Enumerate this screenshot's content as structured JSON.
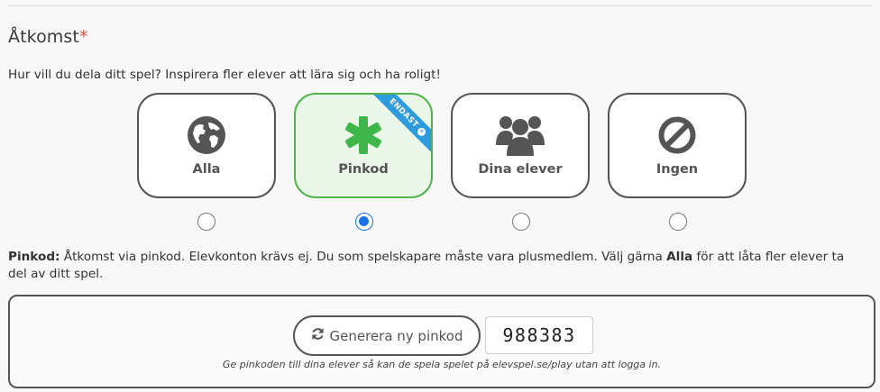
{
  "section": {
    "title": "Åtkomst",
    "required_mark": "*"
  },
  "question": "Hur vill du dela ditt spel? Inspirera fler elever att lära sig och ha roligt!",
  "options": [
    {
      "label": "Alla",
      "icon": "globe-icon",
      "selected": false
    },
    {
      "label": "Pinkod",
      "icon": "asterisk-icon",
      "selected": true,
      "ribbon": "ENDAST"
    },
    {
      "label": "Dina elever",
      "icon": "users-icon",
      "selected": false
    },
    {
      "label": "Ingen",
      "icon": "ban-icon",
      "selected": false
    }
  ],
  "description": {
    "lead": "Pinkod:",
    "text1": " Åtkomst via pinkod. Elevkonton krävs ej. Du som spelskapare måste vara plusmedlem. Välj gärna ",
    "emphasis": "Alla",
    "text2": " för att låta fler elever ta del av ditt spel."
  },
  "pin": {
    "generate_label": "Generera ny pinkod",
    "code": "988383",
    "hint": "Ge pinkoden till dina elever så kan de spela spelet på elevspel.se/play utan att logga in."
  },
  "colors": {
    "selected_border": "#52b44c",
    "selected_bg": "#eaf6e8",
    "ribbon": "#2e9bdc",
    "radio_checked": "#1a73e8",
    "required": "#d9534f"
  }
}
